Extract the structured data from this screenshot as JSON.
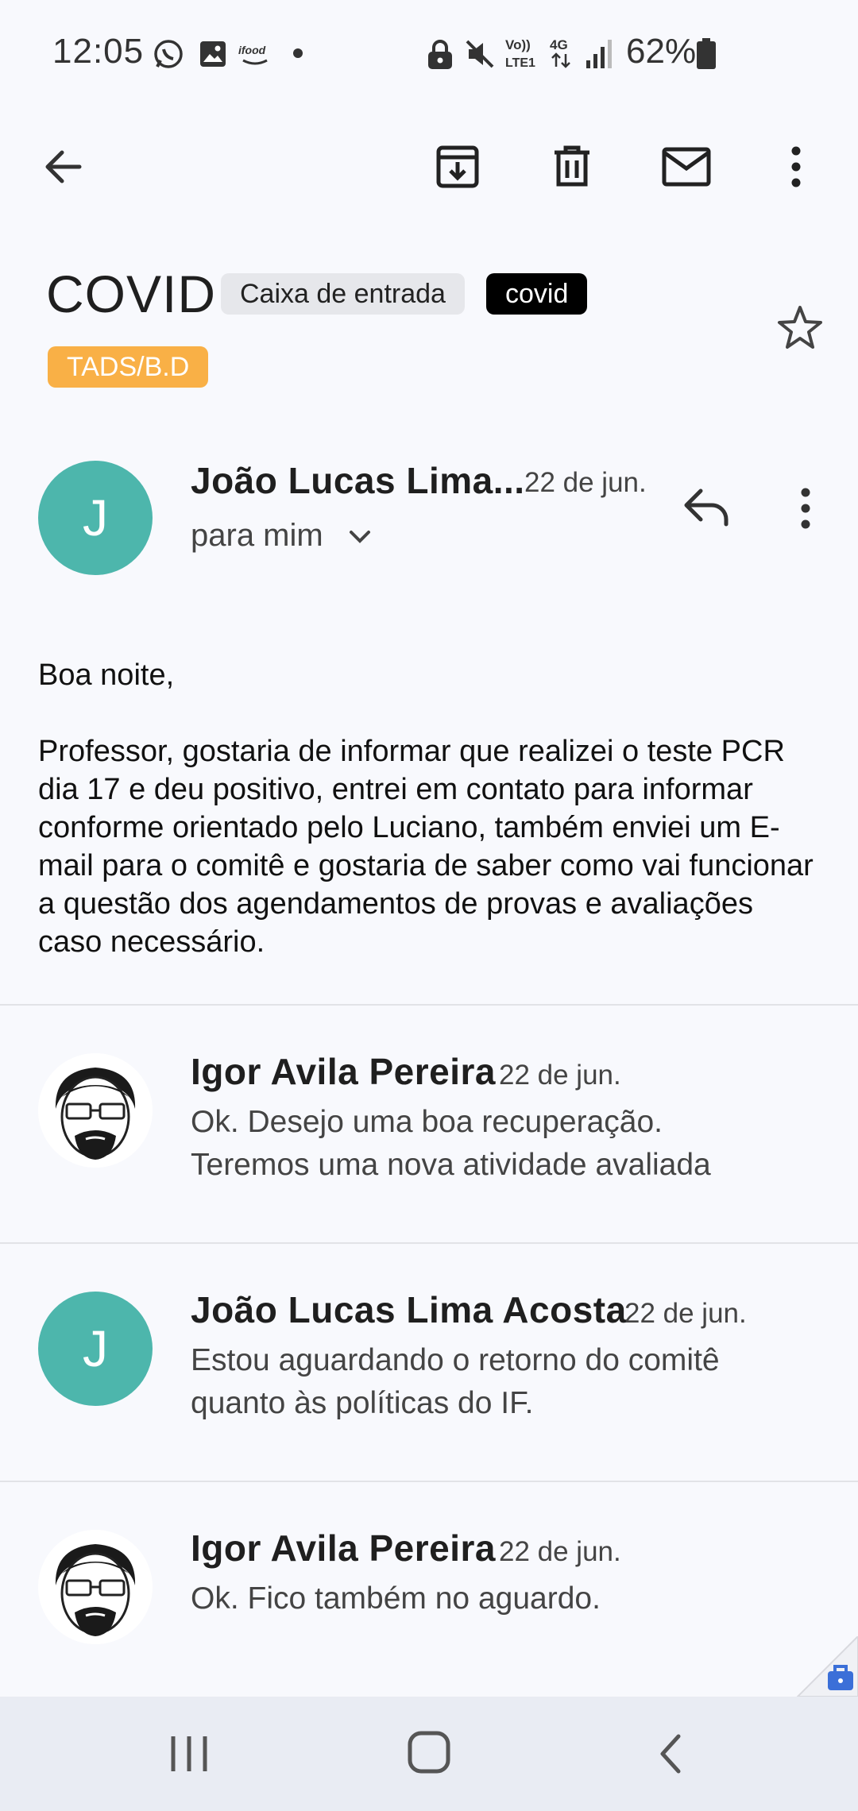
{
  "status_bar": {
    "time": "12:05",
    "battery": "62%",
    "network": "4G",
    "volte": "Vo)) LTE1"
  },
  "toolbar": {
    "back_icon": "arrow-back-icon",
    "archive_icon": "archive-icon",
    "delete_icon": "trash-icon",
    "mark_unread_icon": "mail-icon",
    "more_icon": "more-vert-icon"
  },
  "subject": {
    "title": "COVID",
    "labels": [
      "Caixa de entrada",
      "covid",
      "TADS/B.D"
    ]
  },
  "expanded_message": {
    "avatar_letter": "J",
    "sender": "João Lucas Lima...",
    "date": "22 de jun.",
    "to": "para mim",
    "greeting": "Boa noite,",
    "body": "Professor, gostaria de informar que realizei o teste PCR dia 17 e deu positivo, entrei em contato para informar conforme orientado pelo Luciano, também enviei um E-mail para o comitê e gostaria de saber como vai funcionar a questão dos agendamentos de provas e avaliações caso necessário."
  },
  "thread": [
    {
      "sender": "Igor Avila Pereira",
      "date": "22 de jun.",
      "line1": "Ok. Desejo uma boa recuperação.",
      "line2": "Teremos uma nova atividade avaliada"
    },
    {
      "sender": "João Lucas Lima Acosta",
      "date": "22 de jun.",
      "avatar_letter": "J",
      "line1": "Estou aguardando o retorno do comitê",
      "line2": "quanto às políticas do IF."
    },
    {
      "sender": "Igor Avila Pereira",
      "date": "22 de jun.",
      "line1": "Ok. Fico também no aguardo."
    }
  ],
  "colors": {
    "avatar_teal": "#4db6ac",
    "label_orange": "#f9b046",
    "background": "#f8f9fd"
  }
}
